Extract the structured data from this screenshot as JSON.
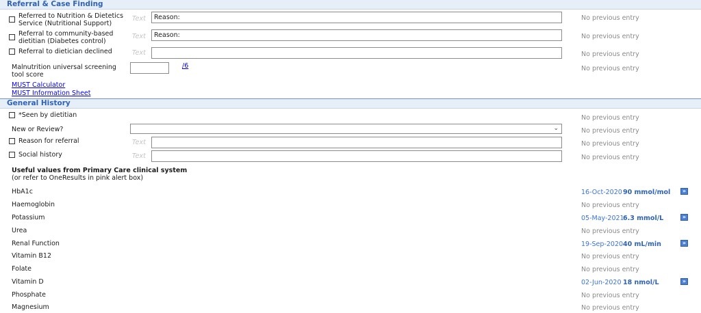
{
  "referral": {
    "header": "Referral & Case Finding",
    "nutrition_label": "Referred to Nutrition & Dietetics Service (Nutritional Support)",
    "nutrition_hint": "Text",
    "nutrition_value": "Reason:",
    "nutrition_prev": "No previous entry",
    "community_label": "Referral to community-based dietitian (Diabetes control)",
    "community_hint": "Text",
    "community_value": "Reason:",
    "community_prev": "No previous entry",
    "declined_label": "Referral to dietician declined",
    "declined_hint": "Text",
    "declined_value": "",
    "declined_prev": "No previous entry",
    "must_label": "Malnutrition universal screening tool score",
    "must_value": "",
    "must_max": "/6",
    "must_prev": "No previous entry",
    "must_calculator": "MUST Calculator",
    "must_info": "MUST Information Sheet"
  },
  "general": {
    "header": "General History",
    "seen_label": "*Seen by dietitian",
    "seen_prev": "No previous entry",
    "new_review_label": "New or Review?",
    "new_review_value": "",
    "new_review_prev": "No previous entry",
    "reason_label": "Reason for referral",
    "reason_hint": "Text",
    "reason_value": "",
    "reason_prev": "No previous entry",
    "social_label": "Social history",
    "social_hint": "Text",
    "social_value": "",
    "social_prev": "No previous entry",
    "useful_title": "Useful values from Primary Care clinical system",
    "useful_sub": "(or refer to OneResults in pink alert box)"
  },
  "labs": [
    {
      "name": "HbA1c",
      "date": "16-Oct-2020",
      "value": "90 mmol/mol",
      "prev": ""
    },
    {
      "name": "Haemoglobin",
      "date": "",
      "value": "",
      "prev": "No previous entry"
    },
    {
      "name": "Potassium",
      "date": "05-May-2021",
      "value": "6.3 mmol/L",
      "prev": ""
    },
    {
      "name": "Urea",
      "date": "",
      "value": "",
      "prev": "No previous entry"
    },
    {
      "name": "Renal Function",
      "date": "19-Sep-2020",
      "value": "40 mL/min",
      "prev": ""
    },
    {
      "name": "Vitamin B12",
      "date": "",
      "value": "",
      "prev": "No previous entry"
    },
    {
      "name": "Folate",
      "date": "",
      "value": "",
      "prev": "No previous entry"
    },
    {
      "name": "Vitamin D",
      "date": "02-Jun-2020",
      "value": "18 nmol/L",
      "prev": ""
    },
    {
      "name": "Phosphate",
      "date": "",
      "value": "",
      "prev": "No previous entry"
    },
    {
      "name": "Magnesium",
      "date": "",
      "value": "",
      "prev": "No previous entry"
    }
  ],
  "icons": {
    "jump": "double-chevron-right-icon",
    "chevron": "chevron-down-icon",
    "jump_glyph": "»",
    "chevron_glyph": "⌄"
  },
  "colors": {
    "header_text": "#2e62b7",
    "value": "#2e62b7",
    "date": "#3b73d6",
    "link": "#0000ee"
  }
}
